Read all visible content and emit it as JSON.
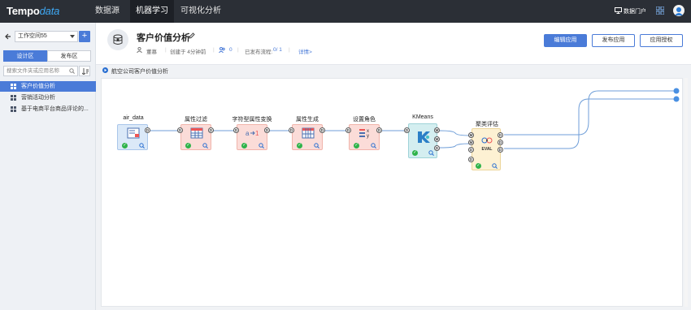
{
  "brand": {
    "name_prefix": "Tempo",
    "name_suffix": "data"
  },
  "nav": [
    "数据源",
    "机器学习",
    "可视化分析"
  ],
  "top_right": {
    "portal_label": "数据门户"
  },
  "sidebar": {
    "workspace": "工作空间55",
    "add_label": "+",
    "tabs": [
      "设计区",
      "发布区"
    ],
    "search_placeholder": "搜索文件夹或应用名称",
    "items": [
      {
        "label": "客户价值分析",
        "selected": true
      },
      {
        "label": "营销活动分析",
        "selected": false
      },
      {
        "label": "基于电商平台商品评论的...",
        "selected": false
      }
    ]
  },
  "header": {
    "title": "客户价值分析",
    "owner": "董慕",
    "created": "创建于 4分钟前",
    "count": "0",
    "published_prefix": "已发布流程:",
    "published_value": "0/ 1",
    "details_link": "详情>",
    "buttons": {
      "edit": "编辑应用",
      "publish": "发布应用",
      "authorize": "应用授权"
    }
  },
  "breadcrumb": "航空公司客户价值分析",
  "flow": {
    "nodes": [
      {
        "label": "air_data",
        "ports": [
          "D"
        ]
      },
      {
        "label": "属性过滤",
        "ports": [
          "D",
          "D"
        ]
      },
      {
        "label": "字符型属性变换",
        "ports": [
          "D",
          "D"
        ]
      },
      {
        "label": "属性生成",
        "ports": [
          "D",
          "D"
        ]
      },
      {
        "label": "设置角色",
        "ports": [
          "D",
          "D"
        ]
      },
      {
        "label": "KMeans",
        "ports": [
          "D",
          "M",
          "M",
          "D"
        ]
      },
      {
        "label": "聚类评估",
        "ports": [
          "M",
          "M",
          "D",
          "D",
          "D",
          "D",
          "D"
        ],
        "inner_text": "EVAL"
      }
    ]
  },
  "colors": {
    "topbar": "#2b2f36",
    "accent": "#4a7bd8",
    "node_blue": "#dbe9f8",
    "node_red": "#fbdcd8",
    "node_teal": "#d4eef0",
    "node_yellow": "#fdf1d3",
    "ok_green": "#2fb34a"
  }
}
